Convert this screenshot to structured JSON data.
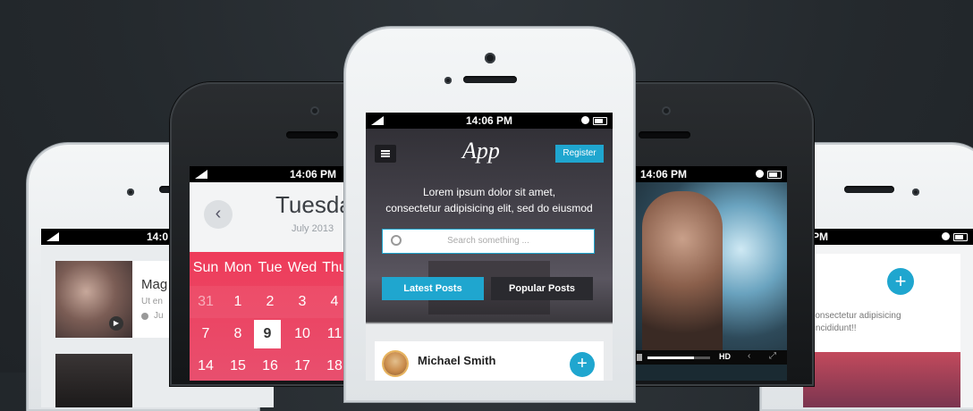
{
  "status": {
    "time": "14:06 PM",
    "time_short": "14:0",
    "time_tail": "5 PM"
  },
  "left_phone": {
    "title_fragment": "Mag",
    "subtitle_fragment": "Ut en",
    "meta_fragment": "Ju"
  },
  "calendar_phone": {
    "day_title": "Tuesday",
    "month_year": "July 2013",
    "weekdays": [
      "Sun",
      "Mon",
      "Tue",
      "Wed",
      "Thu"
    ],
    "row1": [
      "31",
      "1",
      "2",
      "3",
      "4"
    ],
    "row2": [
      "7",
      "8",
      "9",
      "10",
      "11"
    ],
    "row3": [
      "14",
      "15",
      "16",
      "17",
      "18"
    ]
  },
  "main_phone": {
    "logo": "App",
    "register_label": "Register",
    "tagline_line1": "Lorem ipsum dolor sit amet,",
    "tagline_line2": "consectetur adipisicing elit, sed do eiusmod",
    "search_placeholder": "Search something ...",
    "tab_latest": "Latest Posts",
    "tab_popular": "Popular Posts",
    "author_name": "Michael Smith",
    "add_label": "+"
  },
  "video_phone": {
    "hd_label": "HD"
  },
  "right_phone": {
    "text_line1": "t, consectetur adipisicing",
    "text_line2": "re incididunt!!",
    "add_label": "+"
  },
  "colors": {
    "accent": "#1fa6cf",
    "calendar": "#e5375a",
    "dark": "#23282c"
  }
}
